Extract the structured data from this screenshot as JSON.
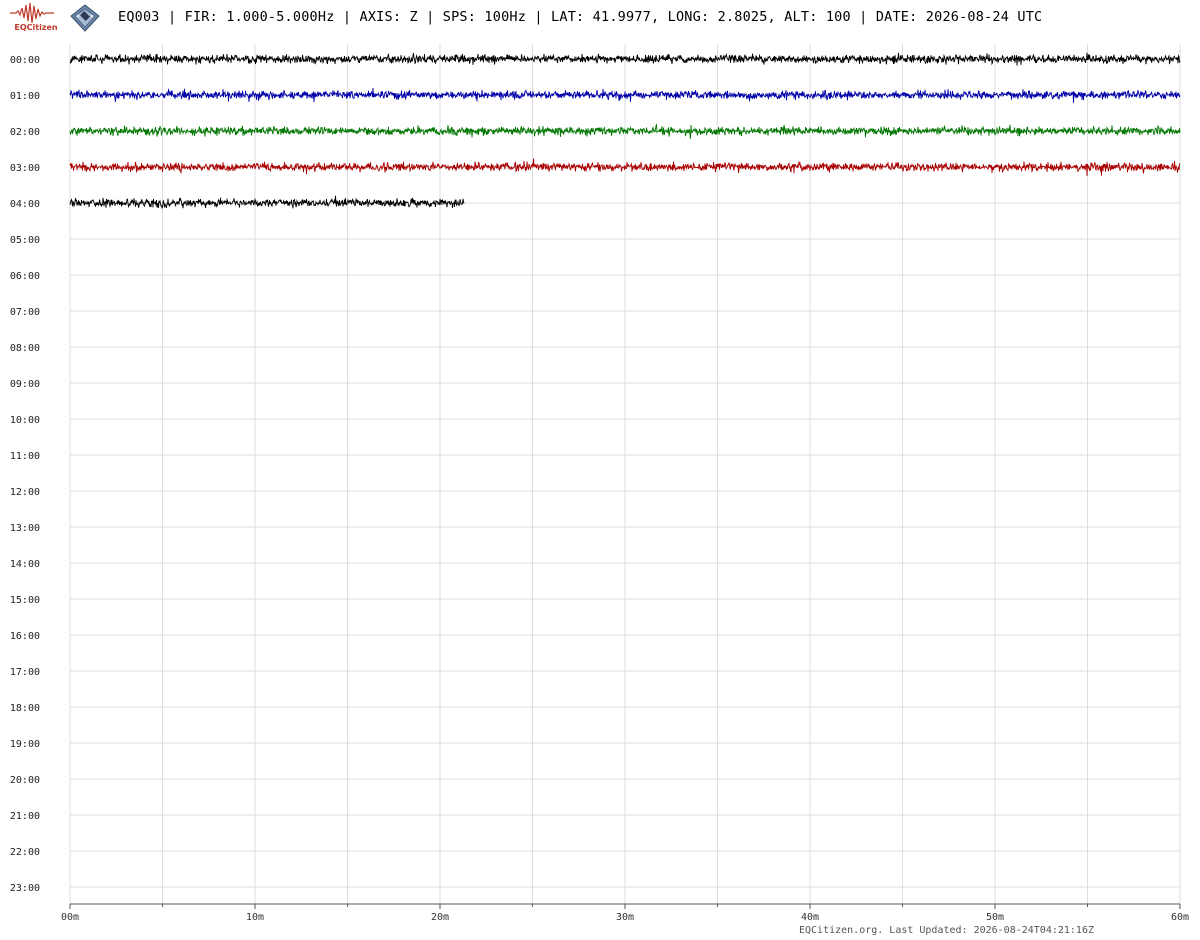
{
  "header": {
    "brand_name": "EQCitizen",
    "brand_icon": "seismogram-wave-icon",
    "sensor_icon": "sensor-board-icon",
    "title": "EQ003 | FIR: 1.000-5.000Hz | AXIS: Z | SPS: 100Hz | LAT: 41.9977, LONG: 2.8025, ALT: 100 | DATE: 2026-08-24 UTC"
  },
  "colors": {
    "brand": "#c0392b",
    "grid": "#dddddd",
    "axis": "#555555",
    "trace_cycle": [
      "#000000",
      "#0000aa",
      "#007700",
      "#aa0000"
    ]
  },
  "footer": {
    "note": "EQCitizen.org. Last Updated: 2026-08-24T04:21:16Z"
  },
  "chart_data": {
    "type": "line",
    "title": "",
    "xlabel": "",
    "ylabel": "",
    "x_tick_labels": [
      "00m",
      "10m",
      "20m",
      "30m",
      "40m",
      "50m",
      "60m"
    ],
    "x_minor_ticks_minutes": [
      5,
      15,
      25,
      35,
      45,
      55
    ],
    "xlim_minutes": [
      0,
      60
    ],
    "y_tick_labels": [
      "00:00",
      "01:00",
      "02:00",
      "03:00",
      "04:00",
      "05:00",
      "06:00",
      "07:00",
      "08:00",
      "09:00",
      "10:00",
      "11:00",
      "12:00",
      "13:00",
      "14:00",
      "15:00",
      "16:00",
      "17:00",
      "18:00",
      "19:00",
      "20:00",
      "21:00",
      "22:00",
      "23:00"
    ],
    "grid": true,
    "series": [
      {
        "hour": "00:00",
        "start_minute": 0,
        "end_minute": 60,
        "color": "#000000"
      },
      {
        "hour": "01:00",
        "start_minute": 0,
        "end_minute": 60,
        "color": "#0000aa"
      },
      {
        "hour": "02:00",
        "start_minute": 0,
        "end_minute": 60,
        "color": "#007700"
      },
      {
        "hour": "03:00",
        "start_minute": 0,
        "end_minute": 60,
        "color": "#aa0000"
      },
      {
        "hour": "04:00",
        "start_minute": 0,
        "end_minute": 21.3,
        "color": "#000000"
      }
    ]
  }
}
